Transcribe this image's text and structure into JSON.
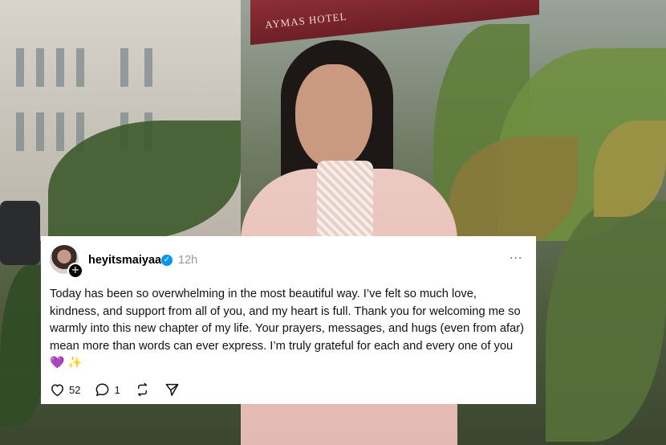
{
  "post": {
    "username": "heyitsmaiyaa",
    "time": "12h",
    "more_label": "···",
    "text_main": "Today has been so overwhelming in the most beautiful way. I’ve felt so much love, kindness, and support from all of you, and my heart is full. Thank you for welcoming me so warmly into this new chapter of my life. Your prayers, messages, and hugs (even from afar) mean more than words can ever express. I’m truly grateful for each and every one of you",
    "emoji_heart": "💜",
    "emoji_spark": "✨",
    "likes": "52",
    "replies": "1",
    "icons": {
      "verified": "verified-badge-icon",
      "follow": "plus-icon",
      "like": "heart-icon",
      "reply": "comment-icon",
      "repost": "repost-icon",
      "share": "send-icon"
    },
    "colors": {
      "verified": "#0095f6",
      "muted": "#999999"
    }
  },
  "background": {
    "awning_text": "AYMAS HOTEL"
  }
}
